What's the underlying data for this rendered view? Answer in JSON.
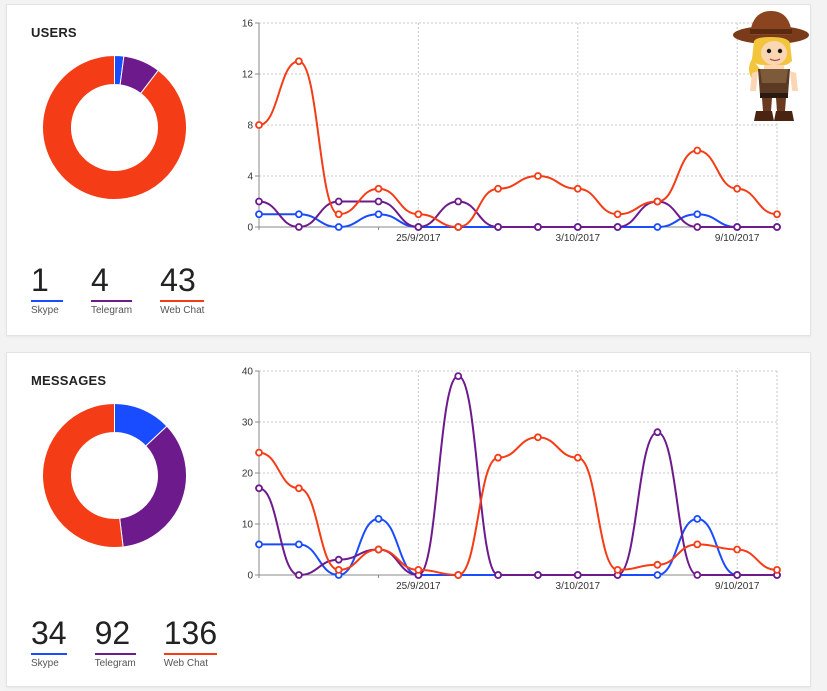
{
  "colors": {
    "skype": "#1a4cff",
    "telegram": "#6d1a8c",
    "webchat": "#f43c16"
  },
  "x_tick_labels": [
    "25/9/2017",
    "3/10/2017",
    "9/10/2017"
  ],
  "panels": [
    {
      "title": "USERS",
      "stats": [
        {
          "value": "1",
          "label": "Skype",
          "color": "#1a4cff"
        },
        {
          "value": "4",
          "label": "Telegram",
          "color": "#6d1a8c"
        },
        {
          "value": "43",
          "label": "Web Chat",
          "color": "#f43c16"
        }
      ]
    },
    {
      "title": "MESSAGES",
      "stats": [
        {
          "value": "34",
          "label": "Skype",
          "color": "#1a4cff"
        },
        {
          "value": "92",
          "label": "Telegram",
          "color": "#6d1a8c"
        },
        {
          "value": "136",
          "label": "Web Chat",
          "color": "#f43c16"
        }
      ]
    }
  ],
  "chart_data": [
    {
      "type": "pie",
      "donut": true,
      "labels": [
        "Skype",
        "Telegram",
        "Web Chat"
      ],
      "values": [
        1,
        4,
        43
      ],
      "colors": [
        "#1a4cff",
        "#6d1a8c",
        "#f43c16"
      ]
    },
    {
      "type": "line",
      "x": [
        0,
        1,
        2,
        3,
        4,
        5,
        6,
        7,
        8,
        9,
        10,
        11,
        12,
        13
      ],
      "x_ticks": [
        {
          "index": 4,
          "label": "25/9/2017"
        },
        {
          "index": 8,
          "label": "3/10/2017"
        },
        {
          "index": 12,
          "label": "9/10/2017"
        }
      ],
      "ylim": [
        0,
        16
      ],
      "yticks": [
        0,
        4,
        8,
        12,
        16
      ],
      "grid": true,
      "series": [
        {
          "key": "skype",
          "color": "#1a4cff",
          "values": [
            1,
            1,
            0,
            1,
            0,
            0,
            0,
            0,
            0,
            0,
            0,
            1,
            0,
            0
          ]
        },
        {
          "key": "telegram",
          "color": "#6d1a8c",
          "values": [
            2,
            0,
            2,
            2,
            0,
            2,
            0,
            0,
            0,
            0,
            2,
            0,
            0,
            0
          ]
        },
        {
          "key": "webchat",
          "color": "#f43c16",
          "values": [
            8,
            13,
            1,
            3,
            1,
            0,
            3,
            4,
            3,
            1,
            2,
            6,
            3,
            1
          ]
        }
      ]
    },
    {
      "type": "pie",
      "donut": true,
      "labels": [
        "Skype",
        "Telegram",
        "Web Chat"
      ],
      "values": [
        34,
        92,
        136
      ],
      "colors": [
        "#1a4cff",
        "#6d1a8c",
        "#f43c16"
      ]
    },
    {
      "type": "line",
      "x": [
        0,
        1,
        2,
        3,
        4,
        5,
        6,
        7,
        8,
        9,
        10,
        11,
        12,
        13
      ],
      "x_ticks": [
        {
          "index": 4,
          "label": "25/9/2017"
        },
        {
          "index": 8,
          "label": "3/10/2017"
        },
        {
          "index": 12,
          "label": "9/10/2017"
        }
      ],
      "ylim": [
        0,
        40
      ],
      "yticks": [
        0,
        10,
        20,
        30,
        40
      ],
      "grid": true,
      "series": [
        {
          "key": "skype",
          "color": "#1a4cff",
          "values": [
            6,
            6,
            0,
            11,
            0,
            0,
            0,
            0,
            0,
            0,
            0,
            11,
            0,
            0
          ]
        },
        {
          "key": "telegram",
          "color": "#6d1a8c",
          "values": [
            17,
            0,
            3,
            5,
            0,
            39,
            0,
            0,
            0,
            0,
            28,
            0,
            0,
            0
          ]
        },
        {
          "key": "webchat",
          "color": "#f43c16",
          "values": [
            24,
            17,
            1,
            5,
            1,
            0,
            23,
            27,
            23,
            1,
            2,
            6,
            5,
            1
          ]
        }
      ]
    }
  ]
}
